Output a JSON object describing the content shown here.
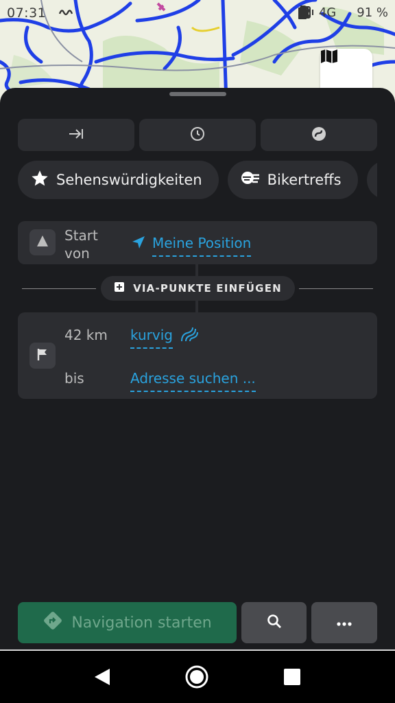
{
  "status_bar": {
    "time": "07:31",
    "network": "4G",
    "battery": "91 %",
    "icons": [
      "wave-icon",
      "alarm-icon",
      "vibrate-icon",
      "location-icon",
      "signal-icon",
      "battery-icon"
    ]
  },
  "map": {
    "toggle_icon": "map-icon"
  },
  "mode_buttons": [
    {
      "icon": "arrow-to-end-icon"
    },
    {
      "icon": "clock-icon"
    },
    {
      "icon": "curvy-road-icon"
    }
  ],
  "chips": [
    {
      "icon": "star-icon",
      "label": "Sehenswürdigkeiten"
    },
    {
      "icon": "biker-icon",
      "label": "Bikertreffs"
    },
    {
      "icon": "navigation-arrow-icon",
      "label": ""
    }
  ],
  "start": {
    "label_line1": "Start",
    "label_line2": "von",
    "value": "Meine Position"
  },
  "via": {
    "label": "VIA-PUNKTE EINFÜGEN"
  },
  "destination": {
    "distance": "42 km",
    "route_type": "kurvig",
    "to_label": "bis",
    "address_placeholder": "Adresse suchen ..."
  },
  "actions": {
    "navigate_label": "Navigation starten"
  },
  "colors": {
    "accent": "#2aa3df",
    "background": "#1b1c1f",
    "card": "#2c2d31",
    "navigate_button": "#1f6a4b"
  }
}
